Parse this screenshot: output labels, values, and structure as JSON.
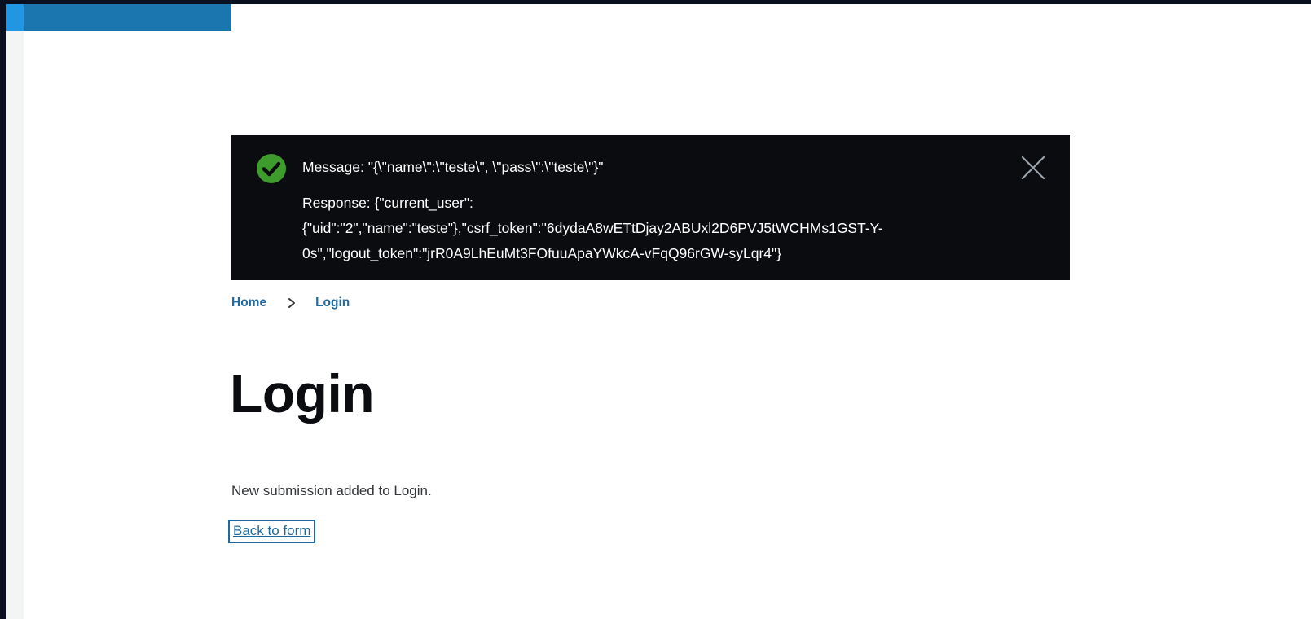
{
  "status": {
    "message": "Message: \"{\\\"name\\\":\\\"teste\\\", \\\"pass\\\":\\\"teste\\\"}\"",
    "response": "Response: {\"current_user\": {\"uid\":\"2\",\"name\":\"teste\"},\"csrf_token\":\"6dydaA8wETtDjay2ABUxl2D6PVJ5tWCHMs1GST-Y-0s\",\"logout_token\":\"jrR0A9LhEuMt3FOfuuApaYWkcA-vFqQ96rGW-syLqr4\"}",
    "icon": "check-circle-icon",
    "close_icon": "close-icon",
    "icon_color": "#3d9c2b"
  },
  "breadcrumb": {
    "items": [
      {
        "label": "Home"
      },
      {
        "label": "Login"
      }
    ],
    "separator_icon": "chevron-right-icon"
  },
  "page": {
    "title": "Login",
    "confirmation_text": "New submission added to Login.",
    "back_link_label": "Back to form"
  },
  "colors": {
    "brand": "#1b75ae",
    "brand_accent": "#2196e3",
    "link": "#1f6aa1",
    "message_bg": "#0b0c0f"
  }
}
